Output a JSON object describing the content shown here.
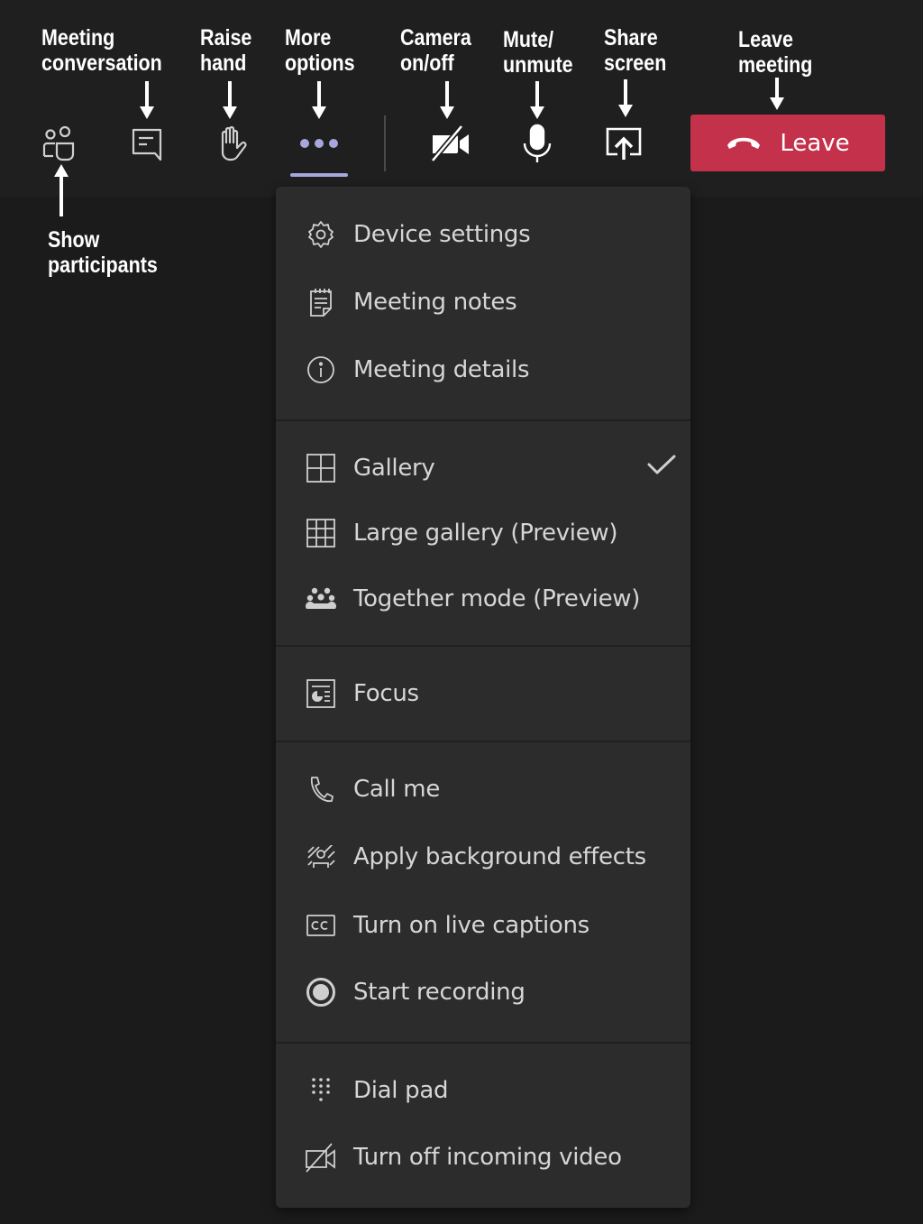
{
  "annotations": {
    "show_participants": "Show\nparticipants",
    "meeting_conversation": "Meeting\nconversation",
    "raise_hand": "Raise\nhand",
    "more_options": "More\noptions",
    "camera": "Camera\non/off",
    "mute": "Mute/\nunmute",
    "share": "Share\nscreen",
    "leave_meeting": "Leave\nmeeting"
  },
  "toolbar": {
    "buttons": [
      {
        "id": "participants",
        "icon": "people-icon"
      },
      {
        "id": "chat",
        "icon": "chat-icon"
      },
      {
        "id": "raise-hand",
        "icon": "hand-icon"
      },
      {
        "id": "more",
        "icon": "ellipsis-icon",
        "active": true
      },
      {
        "id": "camera",
        "icon": "camera-off-icon"
      },
      {
        "id": "mic",
        "icon": "microphone-icon"
      },
      {
        "id": "share",
        "icon": "share-screen-icon"
      }
    ],
    "leave_label": "Leave",
    "colors": {
      "leave": "#c4314b",
      "accent": "#a6a7dc",
      "toolbar_bg": "#1f1f1f",
      "menu_bg": "#2d2c2c"
    }
  },
  "menu": {
    "groups": [
      [
        {
          "label": "Device settings",
          "icon": "gear-icon"
        },
        {
          "label": "Meeting notes",
          "icon": "notes-icon"
        },
        {
          "label": "Meeting details",
          "icon": "info-icon"
        }
      ],
      [
        {
          "label": "Gallery",
          "icon": "gallery-icon",
          "checked": true
        },
        {
          "label": "Large gallery (Preview)",
          "icon": "large-gallery-icon"
        },
        {
          "label": "Together mode (Preview)",
          "icon": "together-mode-icon"
        }
      ],
      [
        {
          "label": "Focus",
          "icon": "focus-icon"
        }
      ],
      [
        {
          "label": "Call me",
          "icon": "phone-icon"
        },
        {
          "label": "Apply background effects",
          "icon": "background-effects-icon"
        },
        {
          "label": "Turn on live captions",
          "icon": "captions-icon"
        },
        {
          "label": "Start recording",
          "icon": "record-icon"
        }
      ],
      [
        {
          "label": "Dial pad",
          "icon": "dialpad-icon"
        },
        {
          "label": "Turn off incoming video",
          "icon": "video-off-icon"
        }
      ]
    ]
  }
}
